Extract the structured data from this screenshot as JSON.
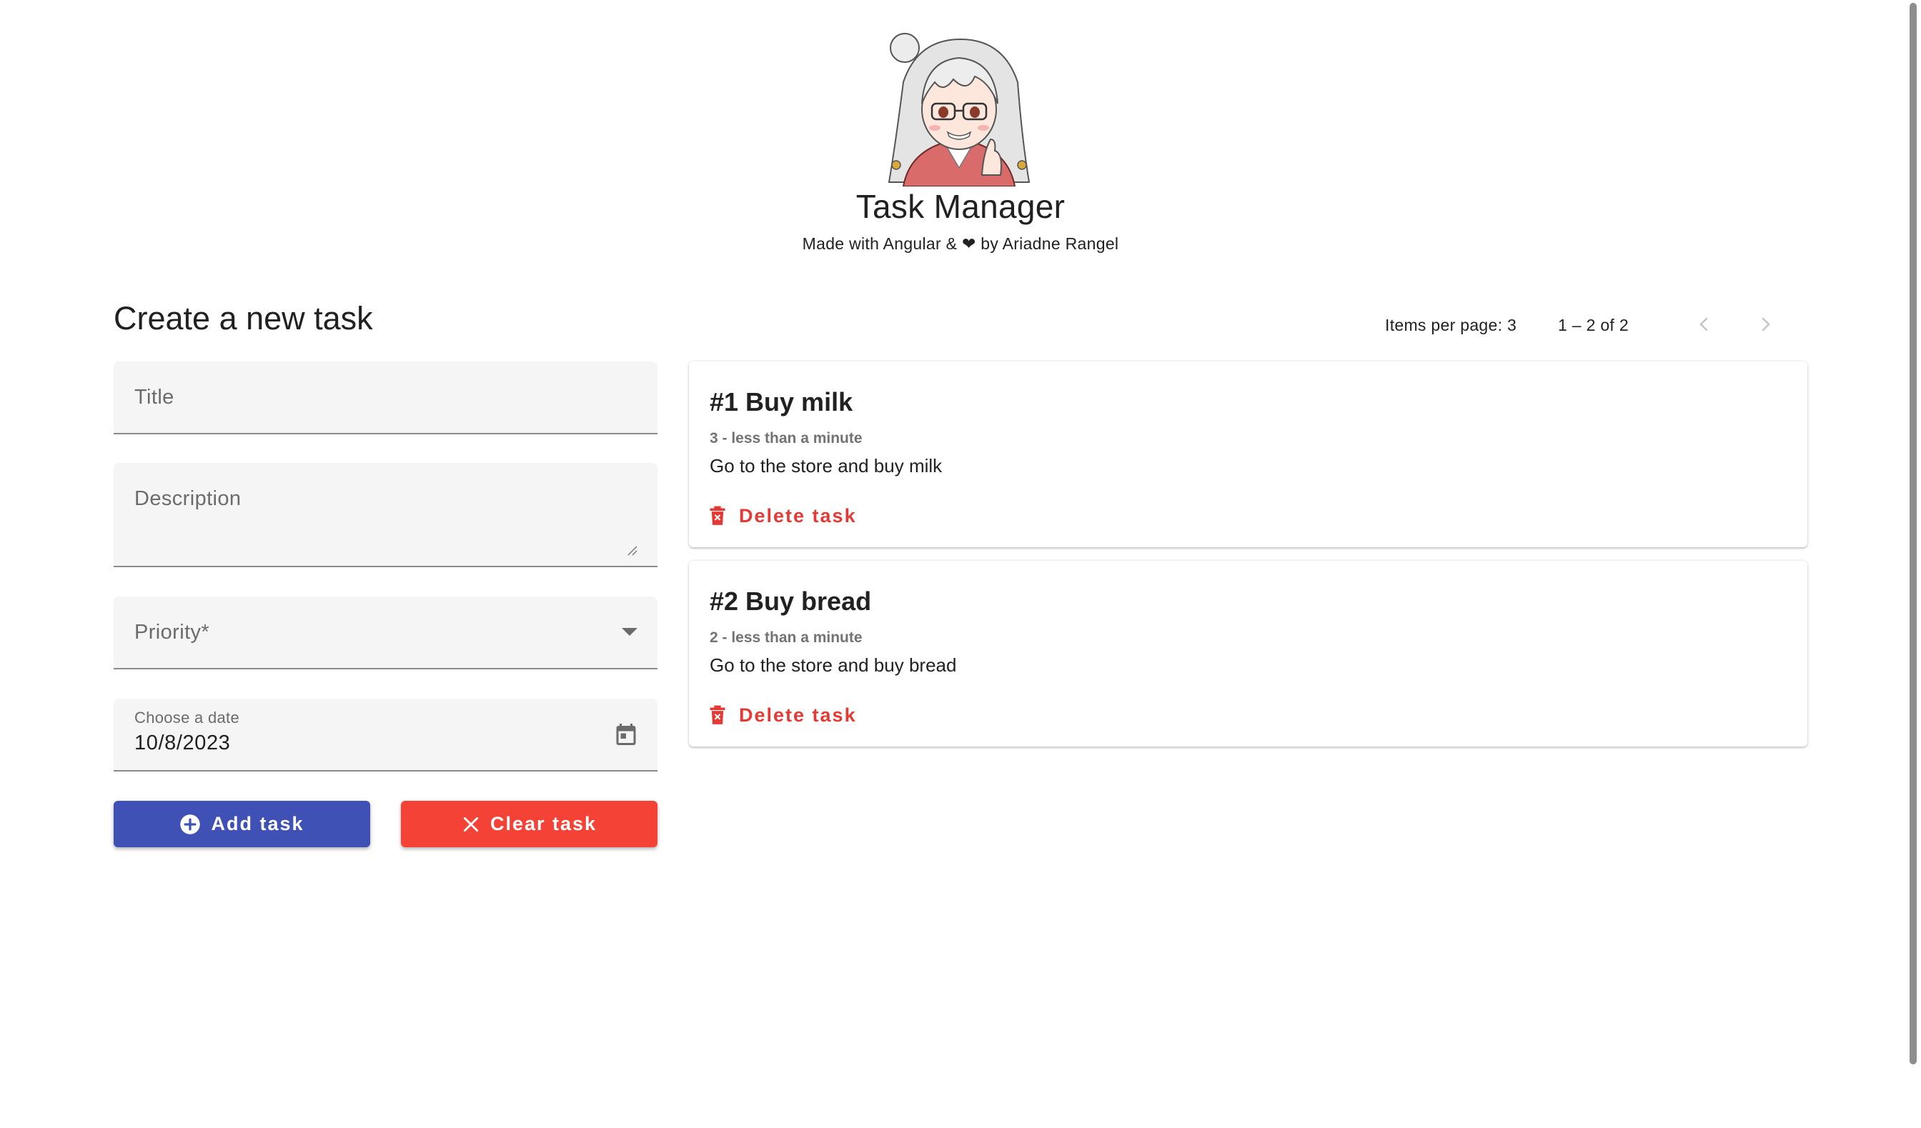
{
  "header": {
    "title": "Task Manager",
    "subtitle_prefix": "Made with Angular & ",
    "heart": "❤",
    "subtitle_suffix": " by Ariadne Rangel"
  },
  "form": {
    "heading": "Create a new task",
    "title_label": "Title",
    "description_label": "Description",
    "priority_label": "Priority*",
    "date_label": "Choose a date",
    "date_value": "10/8/2023",
    "add_label": "Add task",
    "clear_label": "Clear task"
  },
  "paginator": {
    "items_per_page": "Items per page: 3",
    "range": "1 – 2 of 2"
  },
  "tasks": [
    {
      "title": "#1 Buy milk",
      "meta": "3 - less than a minute",
      "description": "Go to the store and buy milk",
      "delete_label": "Delete task"
    },
    {
      "title": "#2 Buy bread",
      "meta": "2 - less than a minute",
      "description": "Go to the store and buy bread",
      "delete_label": "Delete task"
    }
  ],
  "colors": {
    "primary": "#3f51b5",
    "warn": "#f44336",
    "delete_text": "#e53935"
  },
  "icons": {
    "avatar": "anime-girl-avatar",
    "add": "add-circle-icon",
    "clear": "close-icon",
    "calendar": "calendar-icon",
    "dropdown": "chevron-down-icon",
    "delete": "trash-icon",
    "prev": "chevron-left-icon",
    "next": "chevron-right-icon"
  }
}
